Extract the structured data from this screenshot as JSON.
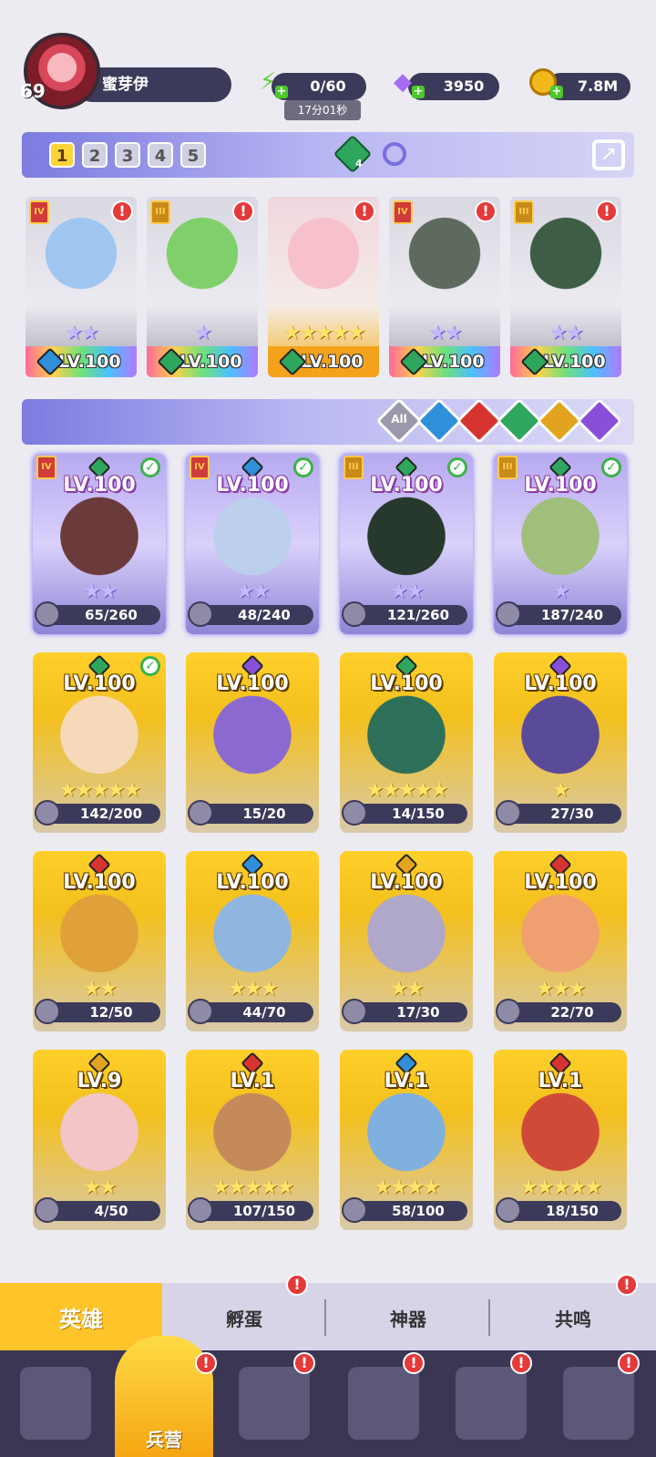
{
  "header": {
    "player_level": "69",
    "player_name": "蜜芽伊",
    "energy": "0/60",
    "energy_timer": "17分01秒",
    "gems": "3950",
    "gold": "7.8M"
  },
  "team_bar": {
    "tabs": [
      "1",
      "2",
      "3",
      "4",
      "5"
    ],
    "active_tab": "1",
    "gem_count": "4"
  },
  "team": [
    {
      "rank": "IV",
      "rank_style": "red",
      "element_color": "#2f8fd8",
      "level": "LV.100",
      "stars": "★★",
      "star_style": "purple",
      "style": "silver",
      "art_color": "#9fc6f0",
      "alert": "!"
    },
    {
      "rank": "III",
      "rank_style": "gold",
      "element_color": "#2ea65d",
      "level": "LV.100",
      "stars": "★",
      "star_style": "purple",
      "style": "silver",
      "art_color": "#7fcf6a",
      "alert": "!"
    },
    {
      "rank": "",
      "rank_style": "none",
      "element_color": "#2ea65d",
      "level": "LV.100",
      "stars": "★★★★★",
      "star_style": "gold",
      "style": "gold",
      "art_color": "#f7c1cc",
      "alert": "!"
    },
    {
      "rank": "IV",
      "rank_style": "red",
      "element_color": "#2ea65d",
      "level": "LV.100",
      "stars": "★★",
      "star_style": "purple",
      "style": "silver",
      "art_color": "#5f6a5e",
      "alert": "!"
    },
    {
      "rank": "III",
      "rank_style": "gold",
      "element_color": "#2ea65d",
      "level": "LV.100",
      "stars": "★★",
      "star_style": "purple",
      "style": "silver",
      "art_color": "#3d5e45",
      "alert": "!"
    }
  ],
  "filters": [
    {
      "label": "All",
      "color": "#9b98ac"
    },
    {
      "label": "",
      "color": "#2f8fd8"
    },
    {
      "label": "",
      "color": "#d8342f"
    },
    {
      "label": "",
      "color": "#2ea65d"
    },
    {
      "label": "",
      "color": "#e2a41e"
    },
    {
      "label": "",
      "color": "#8a4fd8"
    }
  ],
  "heroes": [
    {
      "level": "LV.100",
      "fragments": "65/260",
      "rank": "IV",
      "rank_style": "red",
      "element_color": "#2ea65d",
      "checked": true,
      "stars": "★★",
      "star_style": "purple",
      "style": "violet",
      "art_color": "#6b3a3a"
    },
    {
      "level": "LV.100",
      "fragments": "48/240",
      "rank": "IV",
      "rank_style": "red",
      "element_color": "#2f8fd8",
      "checked": true,
      "stars": "★★",
      "star_style": "purple",
      "style": "violet",
      "art_color": "#bcd0ee"
    },
    {
      "level": "LV.100",
      "fragments": "121/260",
      "rank": "III",
      "rank_style": "gold",
      "element_color": "#2ea65d",
      "checked": true,
      "stars": "★★",
      "star_style": "purple",
      "style": "violet",
      "art_color": "#27382c"
    },
    {
      "level": "LV.100",
      "fragments": "187/240",
      "rank": "III",
      "rank_style": "gold",
      "element_color": "#2ea65d",
      "checked": true,
      "stars": "★",
      "star_style": "purple",
      "style": "violet",
      "art_color": "#9fbf7a"
    },
    {
      "level": "LV.100",
      "fragments": "142/200",
      "rank": "",
      "rank_style": "none",
      "element_color": "#2ea65d",
      "checked": true,
      "stars": "★★★★★",
      "star_style": "gold",
      "style": "gold",
      "art_color": "#f5d9b9"
    },
    {
      "level": "LV.100",
      "fragments": "15/20",
      "rank": "",
      "rank_style": "none",
      "element_color": "#8a4fd8",
      "checked": false,
      "stars": "",
      "star_style": "gold",
      "style": "gold",
      "art_color": "#8a6ad0"
    },
    {
      "level": "LV.100",
      "fragments": "14/150",
      "rank": "",
      "rank_style": "none",
      "element_color": "#2ea65d",
      "checked": false,
      "stars": "★★★★★",
      "star_style": "gold",
      "style": "gold",
      "art_color": "#2e6f5a"
    },
    {
      "level": "LV.100",
      "fragments": "27/30",
      "rank": "",
      "rank_style": "none",
      "element_color": "#8a4fd8",
      "checked": false,
      "stars": "★",
      "star_style": "gold",
      "style": "gold",
      "art_color": "#5a4a9a"
    },
    {
      "level": "LV.100",
      "fragments": "12/50",
      "rank": "",
      "rank_style": "none",
      "element_color": "#d8342f",
      "checked": false,
      "stars": "★★",
      "star_style": "gold",
      "style": "gold",
      "art_color": "#e0a03a"
    },
    {
      "level": "LV.100",
      "fragments": "44/70",
      "rank": "",
      "rank_style": "none",
      "element_color": "#2f8fd8",
      "checked": false,
      "stars": "★★★",
      "star_style": "gold",
      "style": "gold",
      "art_color": "#8fb6e0"
    },
    {
      "level": "LV.100",
      "fragments": "17/30",
      "rank": "",
      "rank_style": "none",
      "element_color": "#e2a41e",
      "checked": false,
      "stars": "★★",
      "star_style": "gold",
      "style": "gold",
      "art_color": "#b0a8c8"
    },
    {
      "level": "LV.100",
      "fragments": "22/70",
      "rank": "",
      "rank_style": "none",
      "element_color": "#d8342f",
      "checked": false,
      "stars": "★★★",
      "star_style": "gold",
      "style": "gold",
      "art_color": "#f0a070"
    },
    {
      "level": "LV.9",
      "fragments": "4/50",
      "rank": "",
      "rank_style": "none",
      "element_color": "#e2a41e",
      "checked": false,
      "stars": "★★",
      "star_style": "gold",
      "style": "gold",
      "art_color": "#f2c6c6"
    },
    {
      "level": "LV.1",
      "fragments": "107/150",
      "rank": "",
      "rank_style": "none",
      "element_color": "#d8342f",
      "checked": false,
      "stars": "★★★★★",
      "star_style": "gold",
      "style": "gold",
      "art_color": "#c58a5a"
    },
    {
      "level": "LV.1",
      "fragments": "58/100",
      "rank": "",
      "rank_style": "none",
      "element_color": "#2f8fd8",
      "checked": false,
      "stars": "★★★★",
      "star_style": "gold",
      "style": "gold",
      "art_color": "#7fb0e0"
    },
    {
      "level": "LV.1",
      "fragments": "18/150",
      "rank": "",
      "rank_style": "none",
      "element_color": "#d8342f",
      "checked": false,
      "stars": "★★★★★",
      "star_style": "gold",
      "style": "gold",
      "art_color": "#d04a3a"
    }
  ],
  "sub_tabs": [
    {
      "label": "英雄",
      "active": true,
      "alert": ""
    },
    {
      "label": "孵蛋",
      "active": false,
      "alert": "!"
    },
    {
      "label": "神器",
      "active": false,
      "alert": ""
    },
    {
      "label": "共鸣",
      "active": false,
      "alert": "!"
    }
  ],
  "bottom_nav": [
    {
      "icon": "cards-icon",
      "label": "",
      "active": false,
      "alert": ""
    },
    {
      "icon": "barracks-icon",
      "label": "兵营",
      "active": true,
      "alert": "!"
    },
    {
      "icon": "map-icon",
      "label": "",
      "active": false,
      "alert": "!"
    },
    {
      "icon": "castle-icon",
      "label": "",
      "active": false,
      "alert": "!"
    },
    {
      "icon": "mushroom-icon",
      "label": "",
      "active": false,
      "alert": "!"
    },
    {
      "icon": "guild-banner-icon",
      "label": "",
      "active": false,
      "alert": "!"
    }
  ]
}
